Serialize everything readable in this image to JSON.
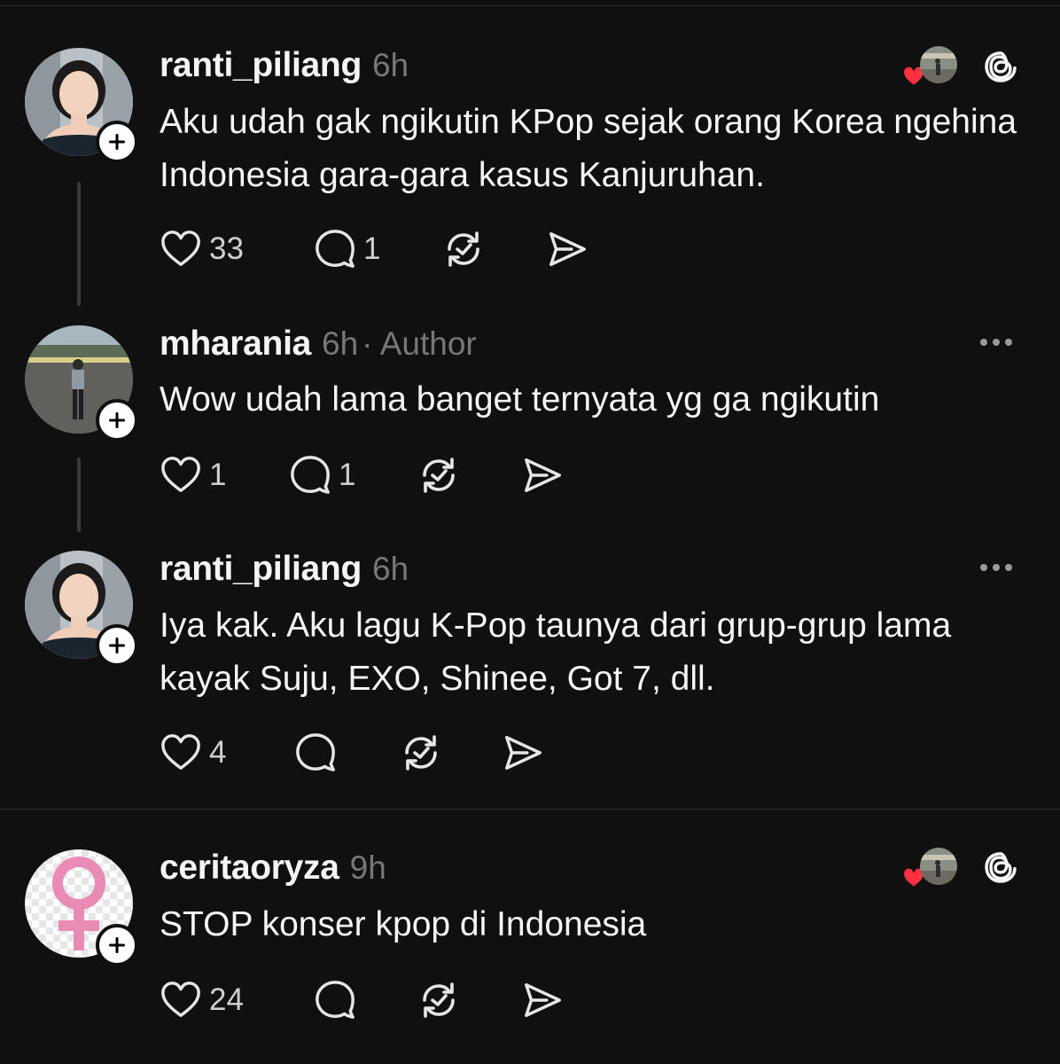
{
  "posts": [
    {
      "username": "ranti_piliang",
      "time": "6h",
      "text": "Aku udah gak ngikutin KPop sejak orang Korea ngehina Indonesia gara-gara kasus Kanjuruhan.",
      "likes": "33",
      "replies": "1"
    },
    {
      "username": "mharania",
      "time": "6h",
      "author": "· Author",
      "text": "Wow udah lama banget ternyata yg ga ngikutin",
      "likes": "1",
      "replies": "1"
    },
    {
      "username": "ranti_piliang",
      "time": "6h",
      "text": "Iya kak. Aku lagu K-Pop taunya dari grup-grup lama kayak Suju, EXO, Shinee, Got 7, dll.",
      "likes": "4",
      "replies": ""
    },
    {
      "username": "ceritaoryza",
      "time": "9h",
      "text": "STOP konser kpop di Indonesia",
      "likes": "24",
      "replies": ""
    }
  ],
  "colors": {
    "background": "#101010",
    "text": "#f3f5f7",
    "muted": "#777777",
    "heart": "#ff3040"
  },
  "icons": [
    "heart-icon",
    "comment-icon",
    "repost-icon",
    "share-icon",
    "more-icon",
    "threads-logo-icon",
    "plus-icon"
  ]
}
